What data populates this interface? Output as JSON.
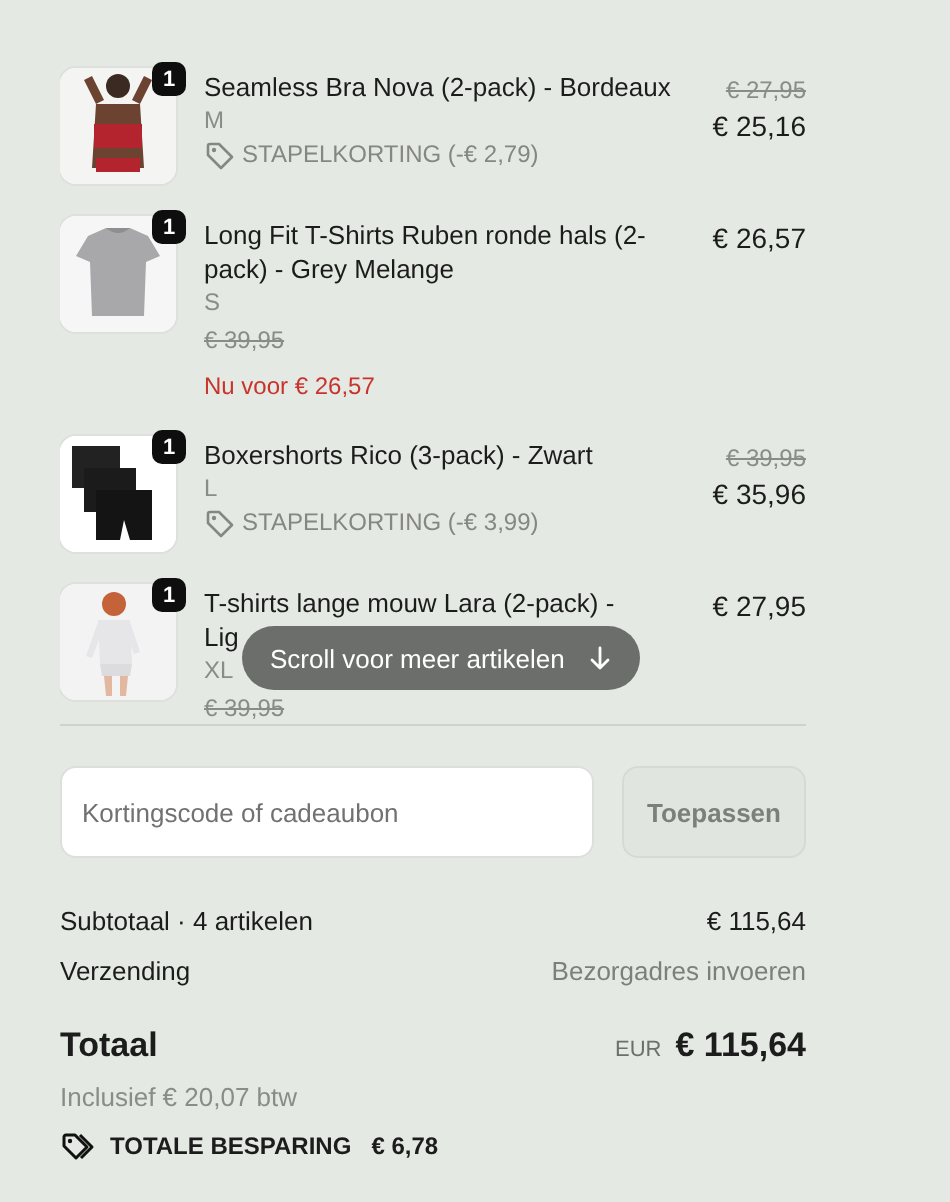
{
  "items": [
    {
      "quantity": "1",
      "name": "Seamless Bra Nova (2-pack) - Bordeaux",
      "size": "M",
      "discount": "STAPELKORTING (-€ 2,79)",
      "old_price": "€ 27,95",
      "price": "€ 25,16"
    },
    {
      "quantity": "1",
      "name": "Long Fit T-Shirts Ruben ronde hals (2-pack) - Grey Melange",
      "size": "S",
      "price": "€ 26,57",
      "was_price": "€ 39,95",
      "sale_note": "Nu voor € 26,57"
    },
    {
      "quantity": "1",
      "name": "Boxershorts Rico (3-pack) - Zwart",
      "size": "L",
      "discount": "STAPELKORTING (-€ 3,99)",
      "old_price": "€ 39,95",
      "price": "€ 35,96"
    },
    {
      "quantity": "1",
      "name": "T-shirts lange mouw Lara (2-pack) -\nLig",
      "size": "XL",
      "price": "€ 27,95",
      "was_price": "€ 39,95"
    }
  ],
  "scroll_hint": "Scroll voor meer artikelen",
  "coupon": {
    "placeholder": "Kortingscode of cadeaubon",
    "button": "Toepassen",
    "button_disabled": true
  },
  "subtotal": {
    "label": "Subtotaal · 4 artikelen",
    "value": "€ 115,64"
  },
  "shipping": {
    "label": "Verzending",
    "value": "Bezorgadres invoeren"
  },
  "total": {
    "label": "Totaal",
    "currency": "EUR",
    "value": "€ 115,64",
    "tax_note": "Inclusief € 20,07 btw"
  },
  "savings": {
    "label": "TOTALE BESPARING",
    "value": "€ 6,78"
  }
}
